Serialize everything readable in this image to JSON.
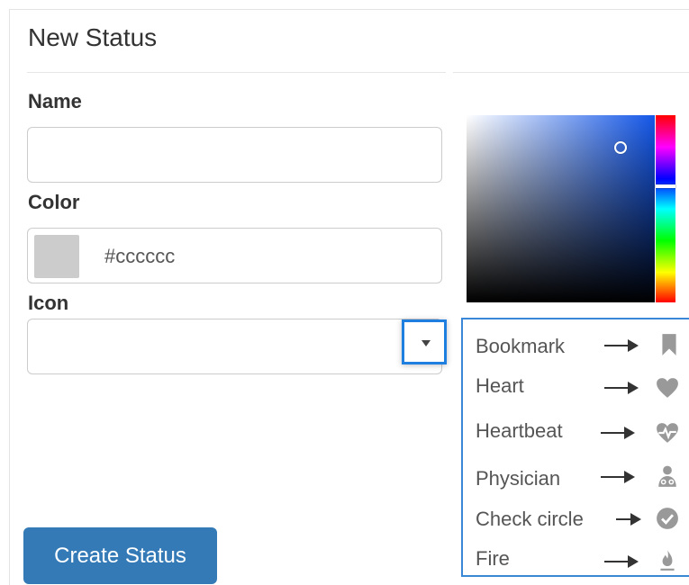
{
  "form": {
    "title": "New Status",
    "name_label": "Name",
    "name_value": "",
    "color_label": "Color",
    "color_value": "#cccccc",
    "icon_label": "Icon",
    "icon_value": "",
    "submit_label": "Create Status"
  },
  "icon_options": [
    {
      "label": "Bookmark",
      "icon": "bookmark-icon"
    },
    {
      "label": "Heart",
      "icon": "heart-icon"
    },
    {
      "label": "Heartbeat",
      "icon": "heartbeat-icon"
    },
    {
      "label": "Physician",
      "icon": "physician-icon"
    },
    {
      "label": "Check circle",
      "icon": "check-circle-icon"
    },
    {
      "label": "Fire",
      "icon": "fire-icon"
    }
  ],
  "colors": {
    "swatch": "#cccccc",
    "picker_hue": "#1457e8",
    "accent": "#337ab7",
    "focus_border": "#1e7fe0",
    "option_icon": "#999999"
  }
}
